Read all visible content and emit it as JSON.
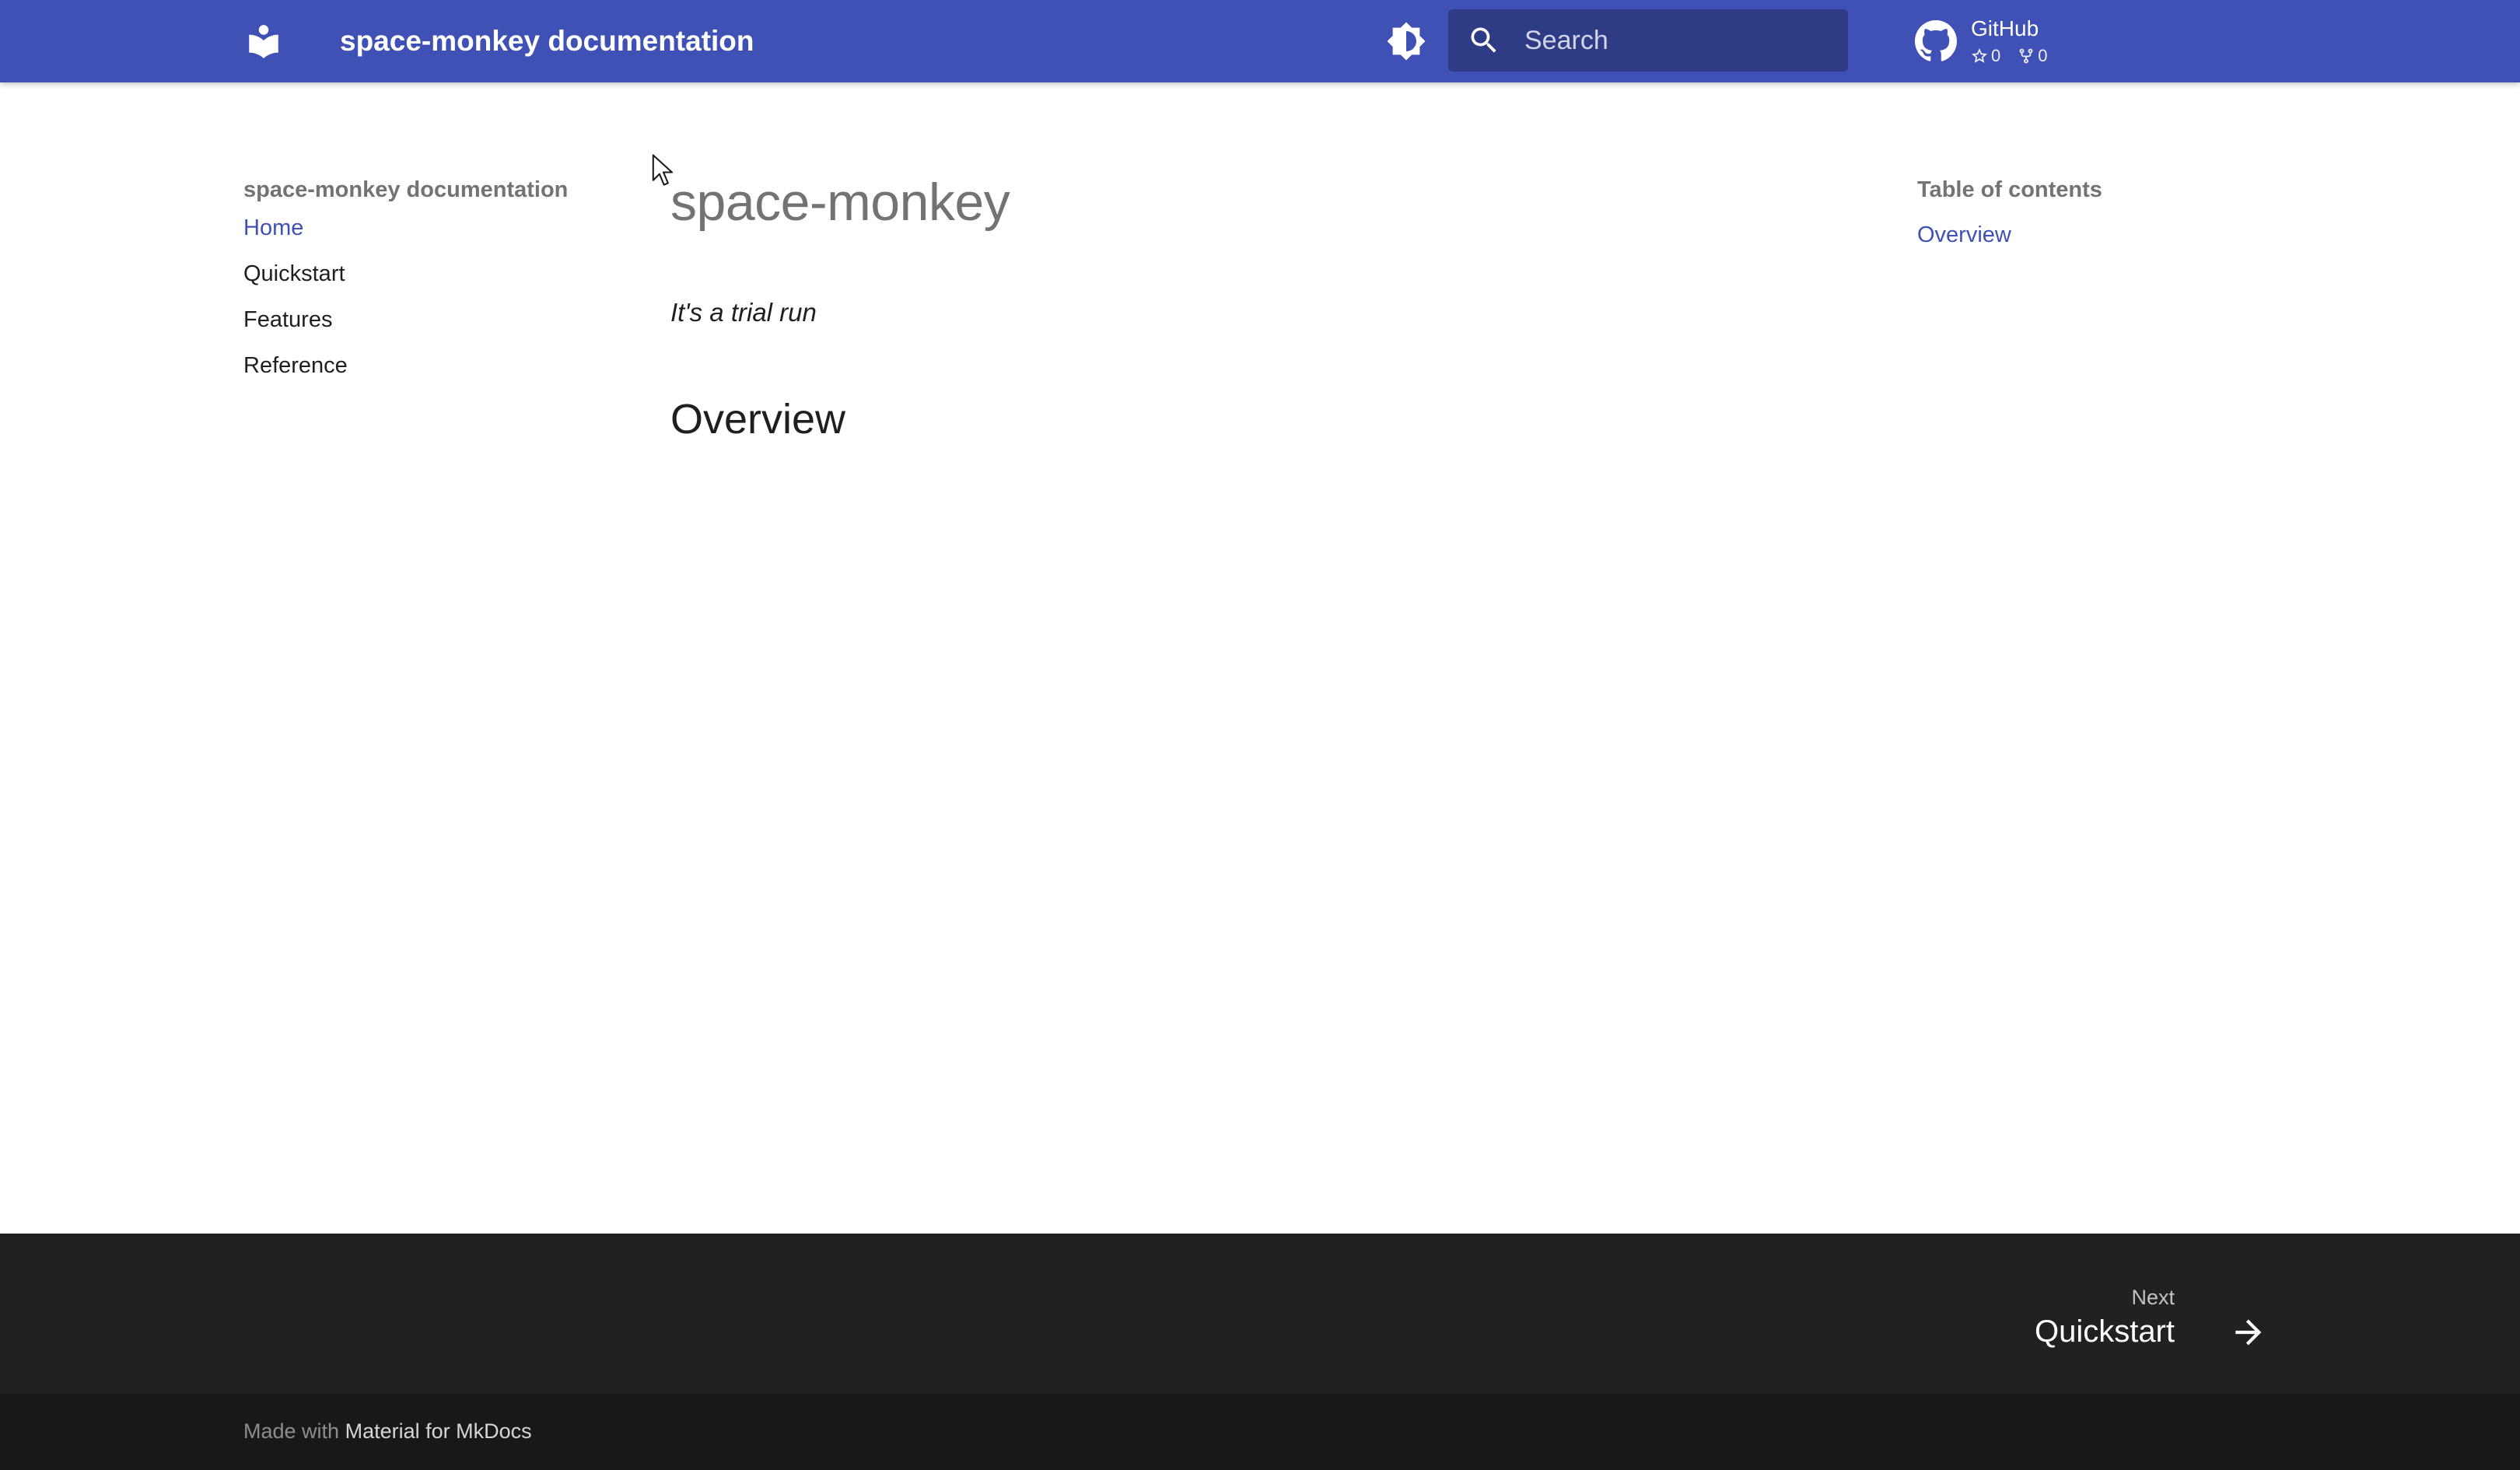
{
  "header": {
    "site_title": "space-monkey documentation",
    "logo_icon": "book-open-icon",
    "theme_toggle_icon": "brightness-icon",
    "search": {
      "icon": "search-icon",
      "placeholder": "Search"
    },
    "repo": {
      "icon": "github-icon",
      "name": "GitHub",
      "stars": "0",
      "forks": "0"
    }
  },
  "nav": {
    "title": "space-monkey documentation",
    "items": [
      {
        "label": "Home",
        "active": true
      },
      {
        "label": "Quickstart",
        "active": false
      },
      {
        "label": "Features",
        "active": false
      },
      {
        "label": "Reference",
        "active": false
      }
    ]
  },
  "content": {
    "title": "space-monkey",
    "tagline": "It's a trial run",
    "section_heading": "Overview"
  },
  "toc": {
    "title": "Table of contents",
    "items": [
      {
        "label": "Overview"
      }
    ]
  },
  "footer": {
    "next": {
      "direction": "Next",
      "title": "Quickstart"
    },
    "made_with_prefix": "Made with",
    "made_with_link": "Material for MkDocs"
  },
  "colors": {
    "primary": "#3f51b5",
    "footer_bg": "#212121",
    "footer_meta_bg": "#181818"
  }
}
